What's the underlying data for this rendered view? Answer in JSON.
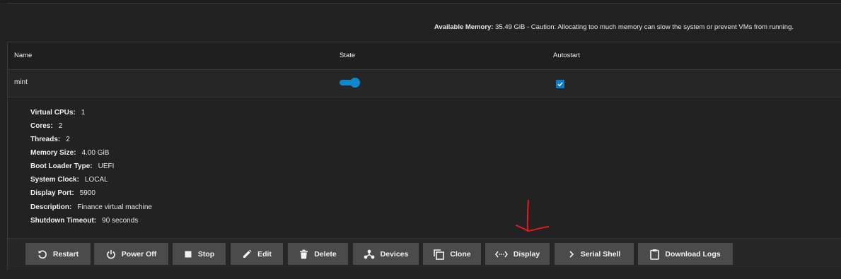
{
  "memory_note": {
    "label": "Available Memory:",
    "text": " 35.49 GiB - Caution: Allocating too much memory can slow the system or prevent VMs from running."
  },
  "table": {
    "headers": {
      "name": "Name",
      "state": "State",
      "autostart": "Autostart"
    }
  },
  "vm": {
    "name": "mint",
    "state_on": true,
    "autostart_checked": true,
    "details": [
      {
        "label": "Virtual CPUs:",
        "value": "1"
      },
      {
        "label": "Cores:",
        "value": "2"
      },
      {
        "label": "Threads:",
        "value": "2"
      },
      {
        "label": "Memory Size:",
        "value": "4.00 GiB"
      },
      {
        "label": "Boot Loader Type:",
        "value": "UEFI"
      },
      {
        "label": "System Clock:",
        "value": "LOCAL"
      },
      {
        "label": "Display Port:",
        "value": "5900"
      },
      {
        "label": "Description:",
        "value": "Finance virtual machine"
      },
      {
        "label": "Shutdown Timeout:",
        "value": "90 seconds"
      }
    ]
  },
  "actions": {
    "restart": "Restart",
    "power_off": "Power Off",
    "stop": "Stop",
    "edit": "Edit",
    "delete": "Delete",
    "devices": "Devices",
    "clone": "Clone",
    "display": "Display",
    "serial_shell": "Serial Shell",
    "download_logs": "Download Logs"
  },
  "colors": {
    "accent": "#0d88d1",
    "annotation": "#e01b1b",
    "button_bg": "#4b4b4b"
  },
  "icons": [
    "restart-icon",
    "power-icon",
    "stop-icon",
    "pencil-icon",
    "trash-icon",
    "devices-icon",
    "clone-icon",
    "display-icon",
    "chevron-right-icon",
    "clipboard-icon"
  ]
}
